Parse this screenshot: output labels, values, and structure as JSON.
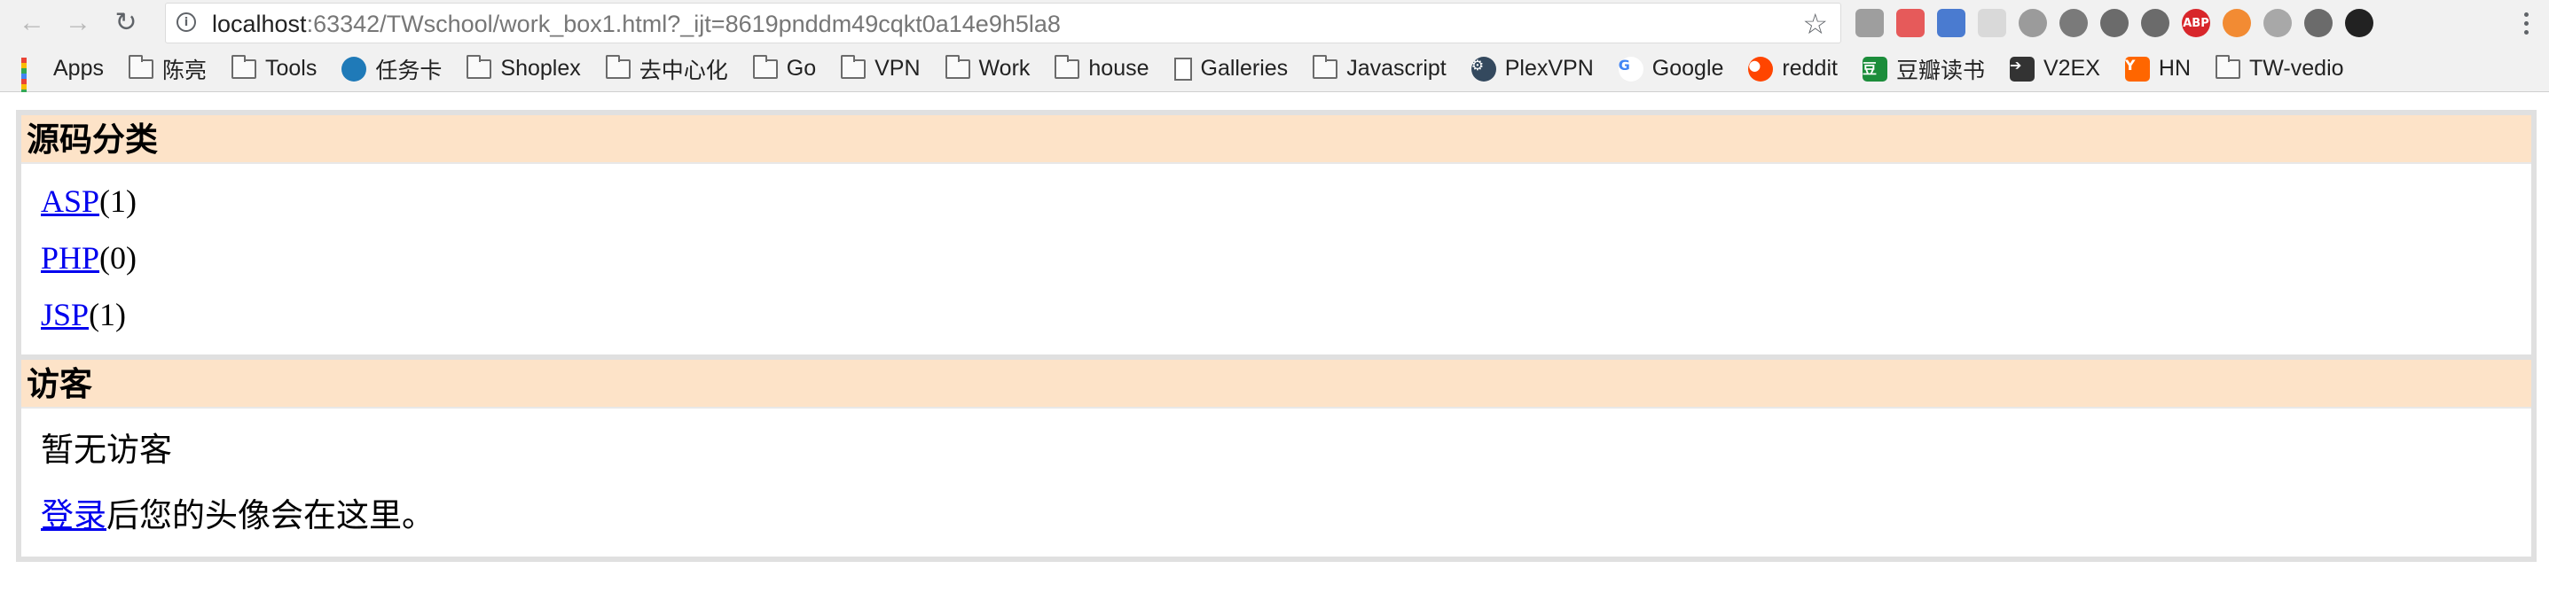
{
  "browser": {
    "url_host": "localhost",
    "url_rest": ":63342/TWschool/work_box1.html?_ijt=8619pnddm49cqkt0a14e9h5la8",
    "extensions": [
      {
        "name": "tab-grid-icon",
        "color": "#9e9e9e",
        "text": ""
      },
      {
        "name": "multi-color-icon",
        "color": "#e65a5a",
        "text": ""
      },
      {
        "name": "chart-bars-icon",
        "color": "#4a7bd0",
        "text": ""
      },
      {
        "name": "shield-icon",
        "color": "#d9d9d9",
        "text": ""
      },
      {
        "name": "circle-icon",
        "color": "#9b9b9b",
        "text": ""
      },
      {
        "name": "film-reel-icon",
        "color": "#7a7a7a",
        "text": ""
      },
      {
        "name": "sync-icon",
        "color": "#6b6b6b",
        "text": ""
      },
      {
        "name": "evernote-icon",
        "color": "#6b6b6b",
        "text": ""
      },
      {
        "name": "adblock-plus-icon",
        "color": "#d8262b",
        "text": "ABP"
      },
      {
        "name": "lifebuoy-icon",
        "color": "#f28b33",
        "text": ""
      },
      {
        "name": "robot-icon",
        "color": "#a8a8a8",
        "text": ""
      },
      {
        "name": "flag-icon",
        "color": "#6b6b6b",
        "text": ""
      },
      {
        "name": "camera-lens-icon",
        "color": "#222222",
        "text": ""
      }
    ]
  },
  "bookmarks": [
    {
      "label": "Apps",
      "icon": "apps-icon"
    },
    {
      "label": "陈亮",
      "icon": "folder-icon"
    },
    {
      "label": "Tools",
      "icon": "folder-icon"
    },
    {
      "label": "任务卡",
      "icon": "trello-icon"
    },
    {
      "label": "Shoplex",
      "icon": "folder-icon"
    },
    {
      "label": "去中心化",
      "icon": "folder-icon"
    },
    {
      "label": "Go",
      "icon": "folder-icon"
    },
    {
      "label": "VPN",
      "icon": "folder-icon"
    },
    {
      "label": "Work",
      "icon": "folder-icon"
    },
    {
      "label": "house",
      "icon": "folder-icon"
    },
    {
      "label": "Galleries",
      "icon": "page-icon"
    },
    {
      "label": "Javascript",
      "icon": "folder-icon"
    },
    {
      "label": "PlexVPN",
      "icon": "gear-icon"
    },
    {
      "label": "Google",
      "icon": "google-icon"
    },
    {
      "label": "reddit",
      "icon": "reddit-icon"
    },
    {
      "label": "豆瓣读书",
      "icon": "douban-icon"
    },
    {
      "label": "V2EX",
      "icon": "v2ex-icon"
    },
    {
      "label": "HN",
      "icon": "hn-icon"
    },
    {
      "label": "TW-vedio",
      "icon": "folder-icon"
    }
  ],
  "page": {
    "categories": {
      "title": "源码分类",
      "items": [
        {
          "link": "ASP",
          "count": "(1)"
        },
        {
          "link": "PHP",
          "count": "(0)"
        },
        {
          "link": "JSP",
          "count": "(1)"
        }
      ]
    },
    "visitors": {
      "title": "访客",
      "empty_text": "暂无访客",
      "login_link": "登录",
      "login_suffix": "后您的头像会在这里。"
    }
  }
}
